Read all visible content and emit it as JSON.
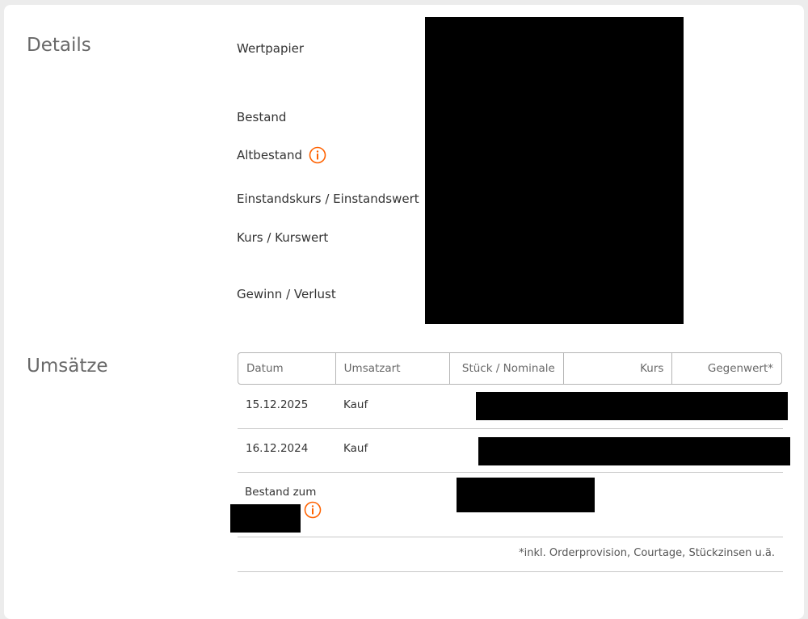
{
  "details": {
    "title": "Details",
    "labels": {
      "wertpapier": "Wertpapier",
      "bestand": "Bestand",
      "altbestand": "Altbestand",
      "einstandskurs": "Einstandskurs / Einstandswert",
      "kurs": "Kurs / Kurswert",
      "gewinn": "Gewinn / Verlust"
    }
  },
  "umsaetze": {
    "title": "Umsätze",
    "columns": [
      "Datum",
      "Umsatzart",
      "Stück / Nominale",
      "Kurs",
      "Gegenwert*"
    ],
    "rows": [
      {
        "datum": "15.12.2025",
        "umsatzart": "Kauf"
      },
      {
        "datum": "16.12.2024",
        "umsatzart": "Kauf"
      }
    ],
    "bestand_label": "Bestand zum",
    "footnote": "*inkl. Orderprovision, Courtage, Stückzinsen u.ä."
  },
  "colors": {
    "accent": "#ff6200",
    "section_title": "#696969",
    "text": "#333333",
    "border": "#b5b5b5"
  },
  "icons": [
    "info-icon"
  ]
}
